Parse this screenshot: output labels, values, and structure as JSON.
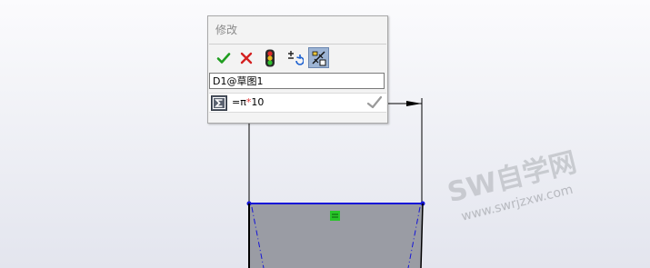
{
  "dialog": {
    "title": "修改",
    "toolbar": [
      {
        "name": "confirm-button",
        "icon": "check-icon"
      },
      {
        "name": "cancel-button",
        "icon": "x-icon"
      },
      {
        "name": "rebuild-button",
        "icon": "traffic-light-icon"
      },
      {
        "name": "reverse-dimension-button",
        "icon": "plus-minus-icon"
      },
      {
        "name": "mark-for-drawing-button",
        "icon": "dimension-tool-icon"
      }
    ],
    "dimension_name": "D1@草图1",
    "equation": {
      "pre": "=π",
      "op": "*",
      "post": "10"
    }
  },
  "watermark": {
    "title": "SW自学网",
    "url": "www.swrjzxw.com"
  },
  "colors": {
    "sketch_blue": "#1414d8",
    "part_fill": "#9a9ca4",
    "relation_green": "#29c529"
  }
}
